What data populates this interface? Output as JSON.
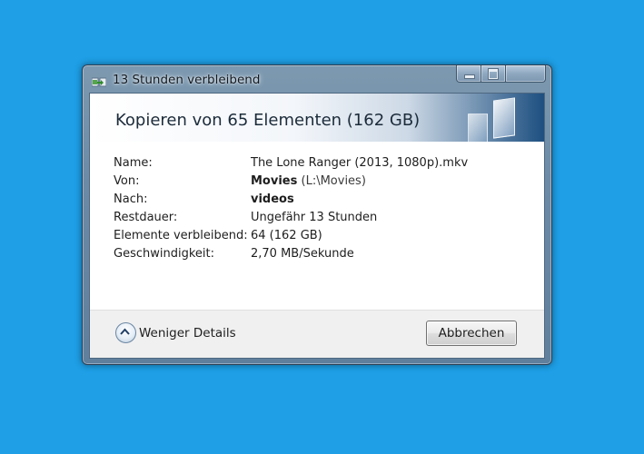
{
  "window": {
    "title": "13 Stunden verbleibend",
    "heading": "Kopieren von 65 Elementen (162 GB)"
  },
  "details": [
    {
      "label": "Name:",
      "value": "The Lone Ranger (2013, 1080p).mkv",
      "bold": "",
      "sub": ""
    },
    {
      "label": "Von:",
      "value": "",
      "bold": "Movies",
      "sub": "(L:\\Movies)"
    },
    {
      "label": "Nach:",
      "value": "",
      "bold": "videos",
      "sub": ""
    },
    {
      "label": "Restdauer:",
      "value": "Ungefähr 13 Stunden",
      "bold": "",
      "sub": ""
    },
    {
      "label": "Elemente verbleibend:",
      "value": "64 (162 GB)",
      "bold": "",
      "sub": ""
    },
    {
      "label": "Geschwindigkeit:",
      "value": "2,70 MB/Sekunde",
      "bold": "",
      "sub": ""
    }
  ],
  "progress": {
    "percent": 0
  },
  "footer": {
    "less_details_label": "Weniger Details",
    "cancel_label": "Abbrechen"
  },
  "icons": {
    "title": "copy-progress-icon",
    "less_details": "chevron-up-circle-icon"
  },
  "colors": {
    "desktop": "#1e9fe6",
    "header_dark": "#1d4f80"
  }
}
